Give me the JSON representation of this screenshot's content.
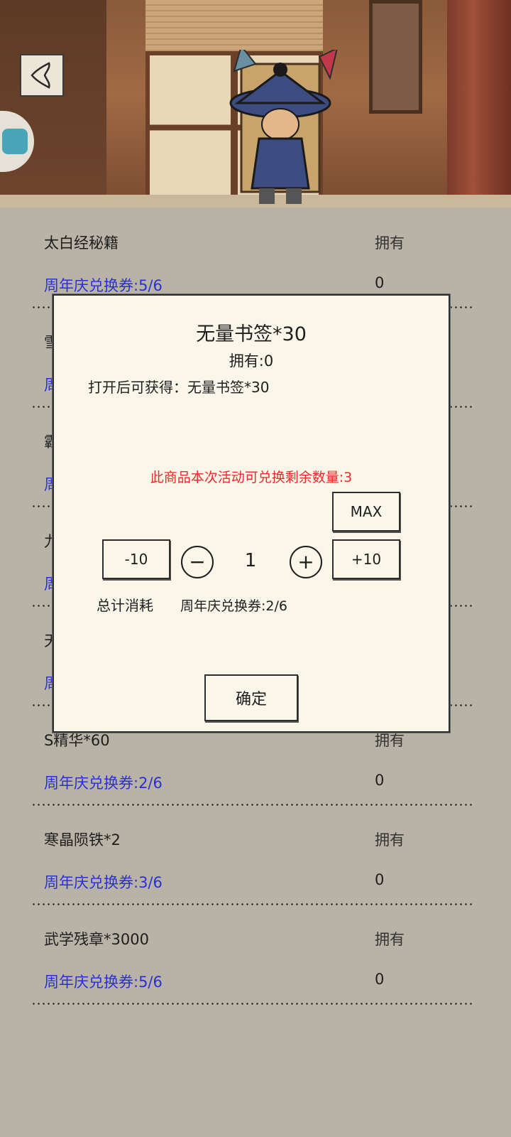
{
  "header": {
    "back_icon": "chevron-left-icon"
  },
  "list": {
    "items": [
      {
        "name": "太白经秘籍",
        "own_label": "拥有",
        "cost": "周年庆兑换券:5/6",
        "own_count": "0"
      },
      {
        "name": "雪",
        "own_label": "",
        "cost": "周",
        "own_count": ""
      },
      {
        "name": "霸",
        "own_label": "",
        "cost": "周",
        "own_count": ""
      },
      {
        "name": "九",
        "own_label": "",
        "cost": "周",
        "own_count": ""
      },
      {
        "name": "天",
        "own_label": "",
        "cost": "周",
        "own_count": ""
      },
      {
        "name": "S精华*60",
        "own_label": "拥有",
        "cost": "周年庆兑换券:2/6",
        "own_count": "0"
      },
      {
        "name": "寒晶陨铁*2",
        "own_label": "拥有",
        "cost": "周年庆兑换券:3/6",
        "own_count": "0"
      },
      {
        "name": "武学残章*3000",
        "own_label": "拥有",
        "cost": "周年庆兑换券:5/6",
        "own_count": "0"
      }
    ]
  },
  "modal": {
    "title": "无量书签*30",
    "owned": "拥有:0",
    "reward": "打开后可获得：无量书签*30",
    "remaining": "此商品本次活动可兑换剩余数量:3",
    "max_label": "MAX",
    "minus10_label": "-10",
    "plus10_label": "+10",
    "minus_icon": "−",
    "plus_icon": "+",
    "quantity": "1",
    "total_label": "总计消耗",
    "total_value": "周年庆兑换券:2/6",
    "confirm_label": "确定"
  },
  "colors": {
    "cost_text": "#2a2fd6",
    "warning_text": "#ec2a2a",
    "modal_bg": "#fbf6ea",
    "page_bg": "#b8b3a6"
  }
}
